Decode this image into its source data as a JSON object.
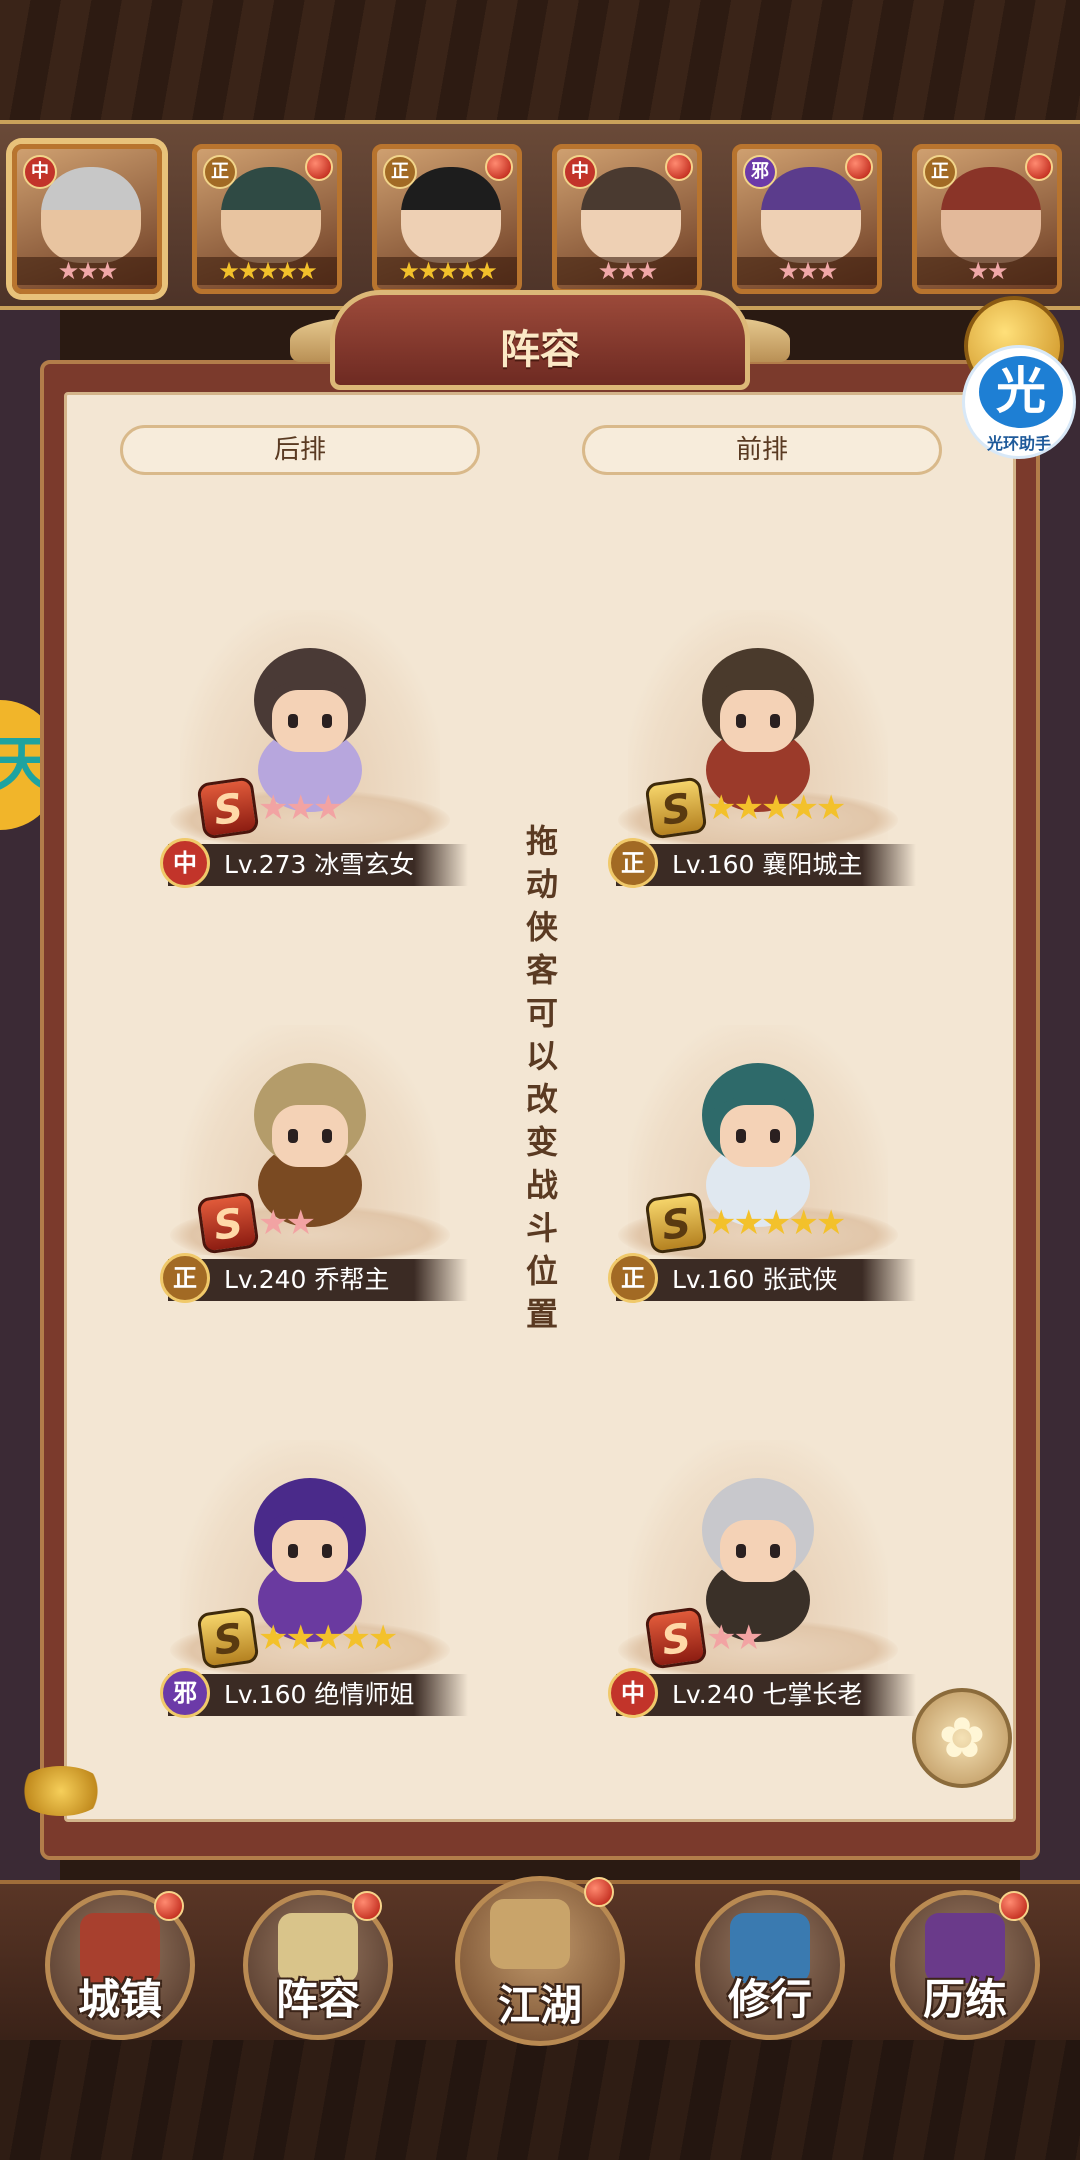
{
  "roster": [
    {
      "faction": "中",
      "stars": "★★★",
      "selected": true,
      "skin": "#e8c4a0",
      "hair": "#c7c7c7"
    },
    {
      "faction": "正",
      "stars": "★★★★★",
      "selected": false,
      "skin": "#e8c4a0",
      "hair": "#2f4a44"
    },
    {
      "faction": "正",
      "stars": "★★★★★",
      "selected": false,
      "skin": "#eed0b4",
      "hair": "#1d1d1d"
    },
    {
      "faction": "中",
      "stars": "★★★",
      "selected": false,
      "skin": "#eed0b4",
      "hair": "#4a3a30"
    },
    {
      "faction": "邪",
      "stars": "★★★",
      "selected": false,
      "skin": "#eed0b4",
      "hair": "#5b3c8c"
    },
    {
      "faction": "正",
      "stars": "★★",
      "selected": false,
      "skin": "#e3b99a",
      "hair": "#8a3428"
    }
  ],
  "panel": {
    "title": "阵容",
    "back_row": "后排",
    "front_row": "前排",
    "hint": "拖动侠客可以改变战斗位置"
  },
  "heroes": [
    {
      "id": "bingxue",
      "faction": "中",
      "level": "Lv.273",
      "name": "冰雪玄女",
      "grade": "S",
      "grade_style": "red",
      "stars": "★★★",
      "star_color": "#f2a3a3",
      "hair": "#4a3a36",
      "robe": "#b7a6dd"
    },
    {
      "id": "xiangyang",
      "faction": "正",
      "level": "Lv.160",
      "name": "襄阳城主",
      "grade": "S",
      "grade_style": "gold",
      "stars": "★★★★★",
      "star_color": "#f3c12b",
      "hair": "#4a3a2c",
      "robe": "#9b3a2a"
    },
    {
      "id": "qiao",
      "faction": "正",
      "level": "Lv.240",
      "name": "乔帮主",
      "grade": "S",
      "grade_style": "red",
      "stars": "★★",
      "star_color": "#f2a3a3",
      "hair": "#b49c6a",
      "robe": "#7a4a22"
    },
    {
      "id": "zhangwu",
      "faction": "正",
      "level": "Lv.160",
      "name": "张武侠",
      "grade": "S",
      "grade_style": "gold",
      "stars": "★★★★★",
      "star_color": "#f3c12b",
      "hair": "#2e6a6a",
      "robe": "#e0e8f0"
    },
    {
      "id": "jueqing",
      "faction": "邪",
      "level": "Lv.160",
      "name": "绝情师姐",
      "grade": "S",
      "grade_style": "gold",
      "stars": "★★★★★",
      "star_color": "#f3c12b",
      "hair": "#4a2a8a",
      "robe": "#6a3aa0"
    },
    {
      "id": "qizhang",
      "faction": "中",
      "level": "Lv.240",
      "name": "七掌长老",
      "grade": "S",
      "grade_style": "red",
      "stars": "★★",
      "star_color": "#f2a3a3",
      "hair": "#c8c8cc",
      "robe": "#3a3028"
    }
  ],
  "helper": {
    "glyph": "光",
    "label": "光环助手"
  },
  "side_token": "天",
  "flower_glyph": "✿",
  "nav": [
    {
      "label": "城镇",
      "icon": "town-icon",
      "dot": true
    },
    {
      "label": "阵容",
      "icon": "formation-icon",
      "dot": true
    },
    {
      "label": "江湖",
      "icon": "jianghu-scroll-icon",
      "dot": true
    },
    {
      "label": "修行",
      "icon": "training-icon",
      "dot": false
    },
    {
      "label": "历练",
      "icon": "trial-icon",
      "dot": true
    }
  ],
  "colors": {
    "zhong": "#c2342a",
    "zheng": "#a26a24",
    "xie": "#6c3aa8",
    "accent": "#dcb878"
  }
}
